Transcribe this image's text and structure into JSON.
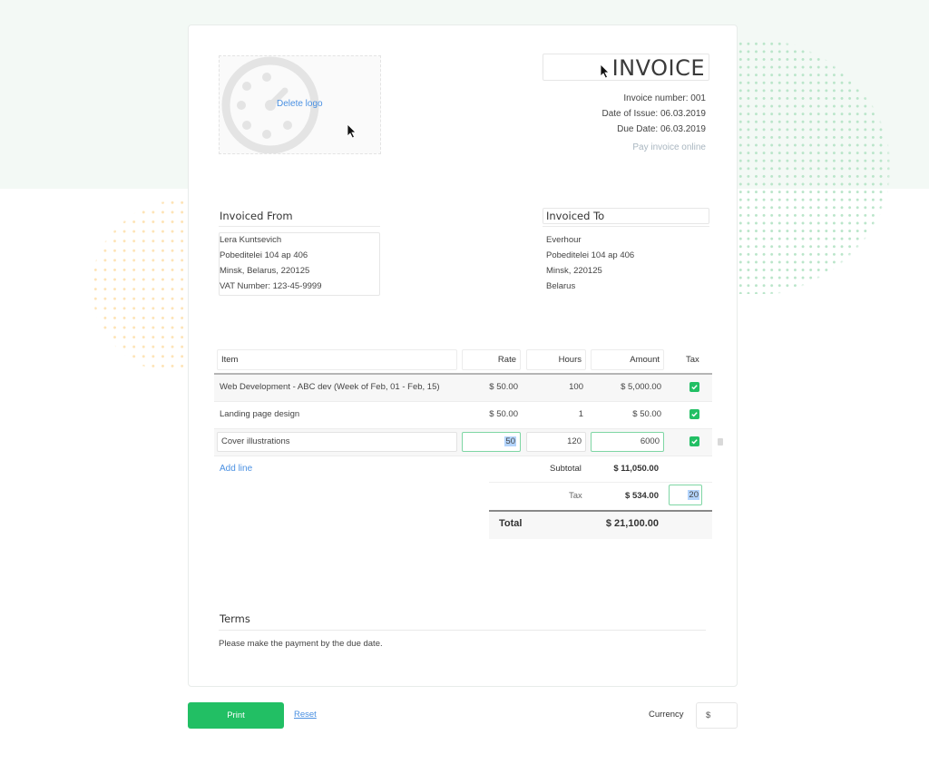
{
  "header": {
    "delete_logo": "Delete logo",
    "title": "INVOICE",
    "invoice_number": "Invoice number: 001",
    "date_of_issue": "Date of Issue: 06.03.2019",
    "due_date": "Due Date: 06.03.2019",
    "pay_online": "Pay invoice online"
  },
  "from": {
    "title": "Invoiced From",
    "lines": [
      "Lera Kuntsevich",
      "Pobeditelei 104 ap 406",
      "Minsk, Belarus, 220125",
      "VAT Number: 123-45-9999"
    ]
  },
  "to": {
    "title": "Invoiced To",
    "lines": [
      "Everhour",
      "Pobeditelei 104 ap 406",
      "Minsk, 220125",
      "Belarus"
    ]
  },
  "table": {
    "headers": {
      "item": "Item",
      "rate": "Rate",
      "hours": "Hours",
      "amount": "Amount",
      "tax": "Tax"
    },
    "rows": [
      {
        "item": "Web Development - ABC dev (Week of Feb, 01 - Feb, 15)",
        "rate": "$ 50.00",
        "hours": "100",
        "amount": "$ 5,000.00",
        "tax": true
      },
      {
        "item": "Landing page design",
        "rate": "$ 50.00",
        "hours": "1",
        "amount": "$ 50.00",
        "tax": true
      },
      {
        "item": "Cover illustrations",
        "rate": "50",
        "hours": "120",
        "amount": "6000",
        "tax": true
      }
    ],
    "add_line": "Add line"
  },
  "totals": {
    "subtotal_label": "Subtotal",
    "subtotal_value": "$ 11,050.00",
    "tax_label": "Tax",
    "tax_value": "$ 534.00",
    "tax_rate": "20",
    "total_label": "Total",
    "total_value": "$ 21,100.00"
  },
  "terms": {
    "title": "Terms",
    "text": "Please make the payment by the due date."
  },
  "footer": {
    "print": "Print",
    "reset": "Reset",
    "currency_label": "Currency",
    "currency_value": "$"
  },
  "colors": {
    "accent_green": "#22bf64",
    "link_blue": "#4a90e2",
    "band": "#f3f9f5"
  }
}
